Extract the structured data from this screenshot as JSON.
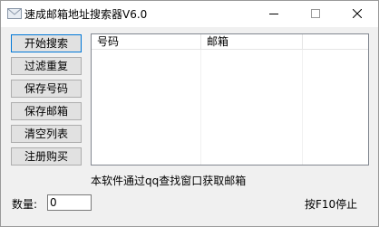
{
  "window": {
    "title": "速成邮箱地址搜索器V6.0"
  },
  "buttons": {
    "start_search": "开始搜索",
    "filter_dupes": "过滤重复",
    "save_qq": "保存号码",
    "save_email": "保存邮箱",
    "clear_list": "清空列表",
    "register": "注册购买"
  },
  "list": {
    "columns": [
      "号码",
      "邮箱"
    ],
    "rows": []
  },
  "info_text": "本软件通过qq查找窗口获取邮箱",
  "quantity": {
    "label": "数量:",
    "value": "0"
  },
  "stop_hint": "按F10停止",
  "icons": {
    "app": "envelope-icon",
    "minimize": "minimize-icon",
    "maximize": "maximize-icon",
    "close": "close-icon"
  }
}
